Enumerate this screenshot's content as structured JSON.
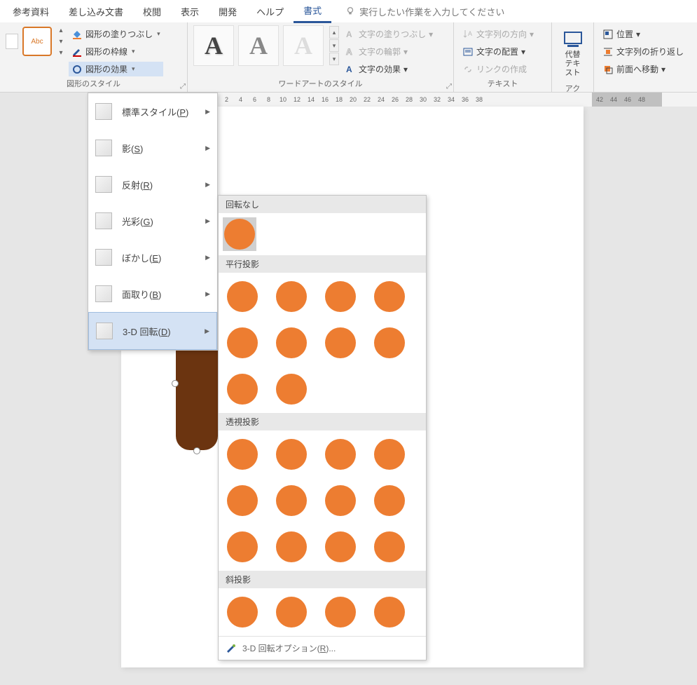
{
  "tabs": {
    "items": [
      "参考資料",
      "差し込み文書",
      "校閲",
      "表示",
      "開発",
      "ヘルプ",
      "書式"
    ],
    "active_index": 6
  },
  "search": {
    "placeholder": "実行したい作業を入力してください"
  },
  "ribbon": {
    "shape_styles": {
      "label": "図形のスタイル",
      "abc": "Abc",
      "fill": "図形の塗りつぶし",
      "outline": "図形の枠線",
      "effects": "図形の効果"
    },
    "wordart": {
      "label": "ワードアートのスタイル",
      "letter": "A"
    },
    "text_style": {
      "fill": "文字の塗りつぶし",
      "outline": "文字の輪郭",
      "effects": "文字の効果"
    },
    "text": {
      "label": "テキスト",
      "direction": "文字列の方向",
      "align": "文字の配置",
      "link": "リンクの作成"
    },
    "alt": {
      "label": "アクセ…",
      "button": "代替テキスト"
    },
    "arrange": {
      "position": "位置",
      "wrap": "文字列の折り返し",
      "front": "前面へ移動"
    }
  },
  "effects_menu": {
    "items": [
      {
        "label": "標準スタイル(",
        "key": "P",
        "suffix": ")"
      },
      {
        "label": "影(",
        "key": "S",
        "suffix": ")"
      },
      {
        "label": "反射(",
        "key": "R",
        "suffix": ")"
      },
      {
        "label": "光彩(",
        "key": "G",
        "suffix": ")"
      },
      {
        "label": "ぼかし(",
        "key": "E",
        "suffix": ")"
      },
      {
        "label": "面取り(",
        "key": "B",
        "suffix": ")"
      },
      {
        "label": "3-D 回転(",
        "key": "D",
        "suffix": ")"
      }
    ],
    "active_index": 6
  },
  "rotation_gallery": {
    "sections": [
      {
        "header": "回転なし",
        "count": 1,
        "boxed": true
      },
      {
        "header": "平行投影",
        "count": 10
      },
      {
        "header": "透視投影",
        "count": 12
      },
      {
        "header": "斜投影",
        "count": 4
      }
    ],
    "footer": "3-D 回転オプション(",
    "footer_key": "R",
    "footer_suffix": ")..."
  },
  "ruler": {
    "numbers": [
      "2",
      "4",
      "6",
      "8",
      "10",
      "12",
      "14",
      "16",
      "18",
      "20",
      "22",
      "24",
      "26",
      "28",
      "30",
      "32",
      "34",
      "36",
      "38"
    ],
    "sel_numbers": [
      "42",
      "44",
      "46",
      "48"
    ]
  }
}
